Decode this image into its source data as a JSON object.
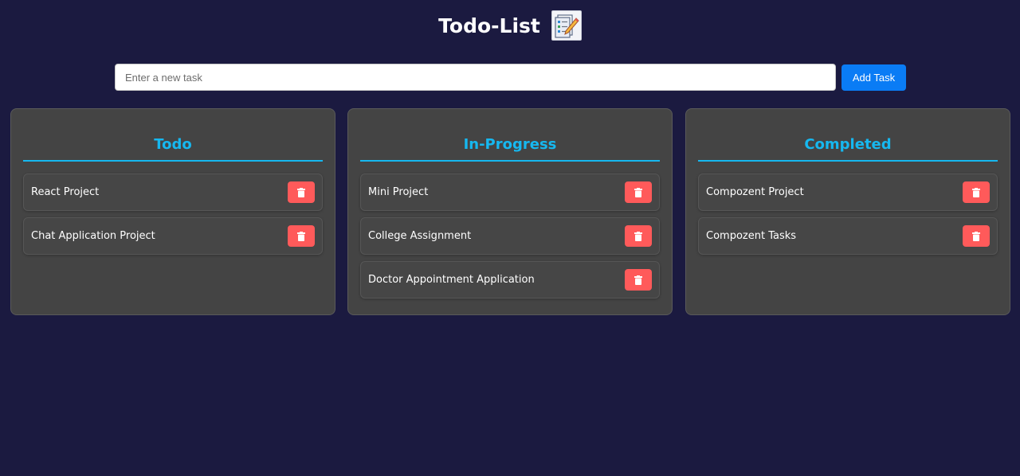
{
  "app": {
    "title": "Todo-List",
    "logo_icon": "notepad-checklist-icon"
  },
  "form": {
    "placeholder": "Enter a new task",
    "value": "",
    "add_label": "Add Task"
  },
  "colors": {
    "background": "#1b1a40",
    "accent": "#16b8f0",
    "add_button": "#0a7cf5",
    "delete_button": "#ff5a5a",
    "card": "#444444"
  },
  "columns": [
    {
      "title": "Todo",
      "tasks": [
        {
          "label": "React Project",
          "icon": "trash-icon"
        },
        {
          "label": "Chat Application Project",
          "icon": "trash-icon"
        }
      ]
    },
    {
      "title": "In-Progress",
      "tasks": [
        {
          "label": "Mini Project",
          "icon": "trash-icon"
        },
        {
          "label": "College Assignment",
          "icon": "trash-icon"
        },
        {
          "label": "Doctor Appointment Application",
          "icon": "trash-icon"
        }
      ]
    },
    {
      "title": "Completed",
      "tasks": [
        {
          "label": "Compozent Project",
          "icon": "trash-icon"
        },
        {
          "label": "Compozent Tasks",
          "icon": "trash-icon"
        }
      ]
    }
  ]
}
